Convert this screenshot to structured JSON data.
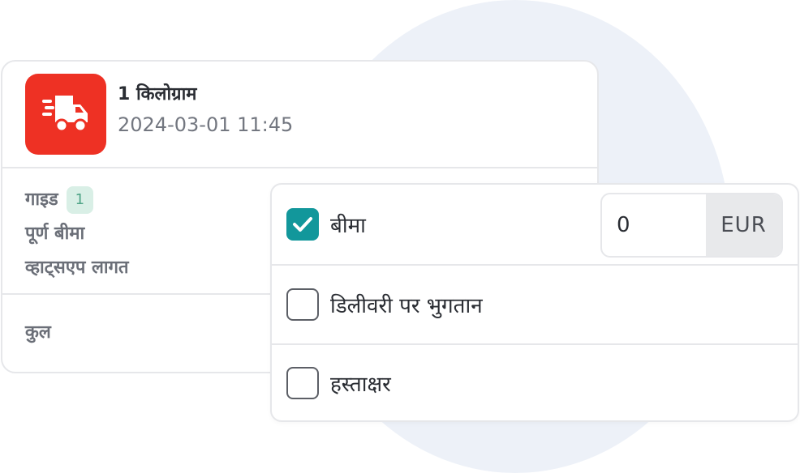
{
  "shipment": {
    "weight": "1 किलोग्राम",
    "datetime": "2024-03-01 11:45"
  },
  "details": {
    "guide_label": "गाइड",
    "guide_badge": "1",
    "full_insurance_label": "पूर्ण बीमा",
    "whatsapp_cost_label": "व्हाट्सएप लागत",
    "total_label": "कुल"
  },
  "options": [
    {
      "label": "बीमा",
      "checked": true,
      "amount": "0",
      "currency": "EUR"
    },
    {
      "label": "डिलीवरी पर भुगतान",
      "checked": false
    },
    {
      "label": "हस्ताक्षर",
      "checked": false
    }
  ],
  "colors": {
    "brand": "#ee3124",
    "checkbox_checked": "#12979b",
    "badge_bg": "#d9efe6"
  },
  "icons": {
    "shipping": "fast-delivery-truck-icon",
    "check": "checkmark-icon"
  }
}
